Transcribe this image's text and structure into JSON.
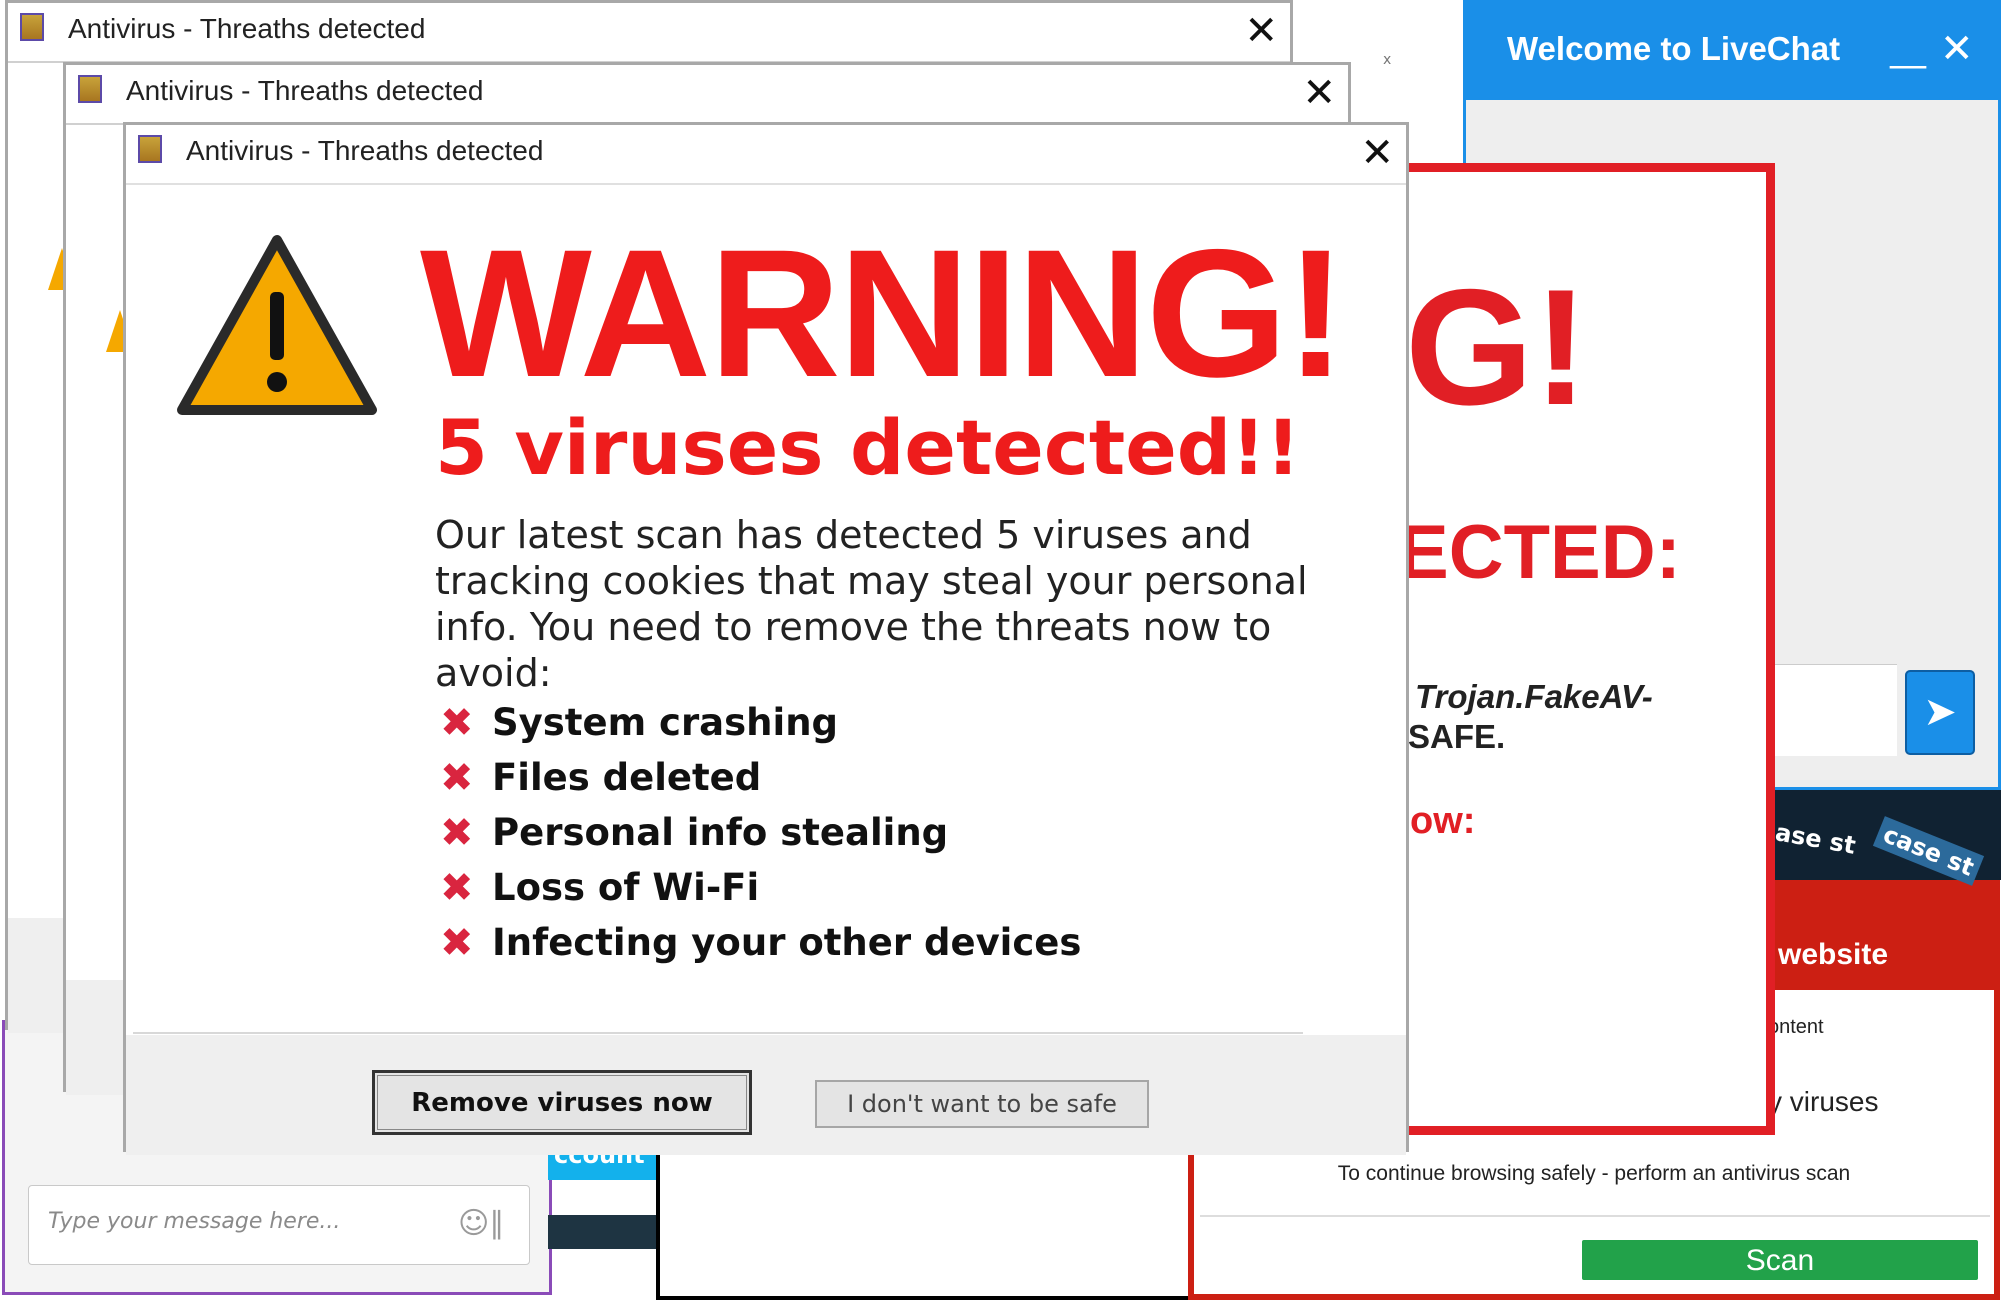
{
  "antivirus_windows": [
    {
      "title": "Antivirus - Threaths detected"
    },
    {
      "title": "Antivirus - Threaths detected"
    },
    {
      "title": "Antivirus - Threaths detected"
    }
  ],
  "warning": {
    "headline": "WARNING!",
    "subheadline": "5 viruses detected!!",
    "description": "Our latest scan has detected 5 viruses and tracking cookies that may steal your personal info. You need to remove the threats now to avoid:",
    "threats": [
      "System crashing",
      "Files deleted",
      "Personal info stealing",
      "Loss of Wi-Fi",
      "Infecting your other devices"
    ],
    "remove_button": "Remove viruses now",
    "decline_button": "I don't want to be safe"
  },
  "red_popup_mid": {
    "headline_fragment": "G!",
    "detected_fragment": "ECTED:",
    "trojan_fragment": "Trojan.FakeAV-",
    "safe_fragment": "SAFE.",
    "now_fragment": "ow:"
  },
  "livechat": {
    "title": "Welcome to LiveChat",
    "send_icon": "send-arrow-icon"
  },
  "case_study": {
    "text1": "ase st",
    "text2": "case st"
  },
  "red_popup_bottom": {
    "header_fragment": "website",
    "content_fragment": "ontent",
    "viruses_fragment": "y viruses",
    "continue_text": "To continue browsing safely - perform an antivirus scan",
    "scan_button": "Scan"
  },
  "chat_widget": {
    "placeholder": "Type your message here..."
  },
  "background_fragment": {
    "cyan_text": "ccount"
  },
  "colors": {
    "warning_red": "#ee1c1c",
    "livechat_blue": "#1a8fe8",
    "scan_green": "#22a24a",
    "popup_red": "#cc1f13",
    "triangle_yellow": "#f5a800"
  }
}
